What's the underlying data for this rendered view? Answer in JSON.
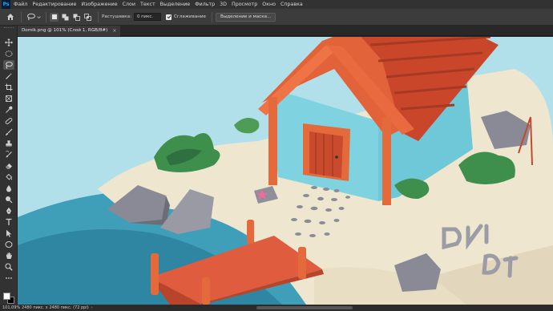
{
  "app": {
    "logo": "Ps",
    "accent": "#31a8ff"
  },
  "menu": [
    "Файл",
    "Редактирование",
    "Изображение",
    "Слои",
    "Текст",
    "Выделение",
    "Фильтр",
    "3D",
    "Просмотр",
    "Окно",
    "Справка"
  ],
  "options": {
    "feather_label": "Растушевка:",
    "feather_value": "0 пикс.",
    "antialias_label": "Сглаживание",
    "antialias_checked": true,
    "select_mask_button": "Выделение и маска..."
  },
  "tab": {
    "title": "Domik.png @ 101% (Слой 1, RGB/8#)",
    "close": "×"
  },
  "tools": [
    "move-tool",
    "marquee-tool",
    "lasso-tool",
    "magic-wand-tool",
    "crop-tool",
    "frame-tool",
    "eyedropper-tool",
    "healing-brush-tool",
    "brush-tool",
    "clone-stamp-tool",
    "history-brush-tool",
    "eraser-tool",
    "paint-bucket-tool",
    "blur-tool",
    "dodge-tool",
    "pen-tool",
    "type-tool",
    "path-selection-tool",
    "rectangle-tool",
    "hand-tool",
    "zoom-tool"
  ],
  "active_tool": "lasso-tool",
  "colors": {
    "foreground": "#ffffff",
    "background": "#000000"
  },
  "status": {
    "zoom": "101,09%",
    "doc": "2480 пикс. x 2480 пикс. (72 ppi)",
    "arrow": "›"
  }
}
